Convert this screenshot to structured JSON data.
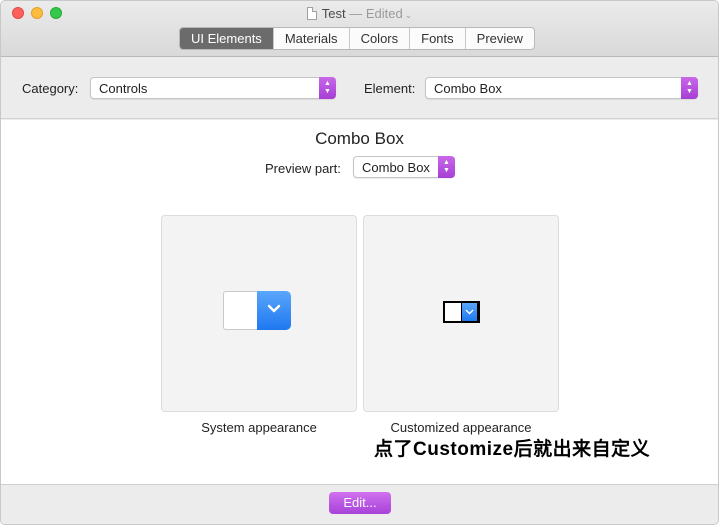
{
  "window": {
    "title": "Test",
    "edited_label": "— Edited",
    "title_chevron": "⌄"
  },
  "tabs": [
    {
      "label": "UI Elements",
      "active": true
    },
    {
      "label": "Materials",
      "active": false
    },
    {
      "label": "Colors",
      "active": false
    },
    {
      "label": "Fonts",
      "active": false
    },
    {
      "label": "Preview",
      "active": false
    }
  ],
  "category": {
    "label": "Category:",
    "value": "Controls"
  },
  "element": {
    "label": "Element:",
    "value": "Combo Box"
  },
  "main": {
    "heading": "Combo Box",
    "preview_part_label": "Preview part:",
    "preview_part_value": "Combo Box"
  },
  "panels": {
    "system_caption": "System appearance",
    "custom_caption": "Customized appearance"
  },
  "annotation": "点了Customize后就出来自定义",
  "footer": {
    "edit_label": "Edit..."
  },
  "colors": {
    "accent_purple": "#b455e0",
    "system_blue": "#2f86f6",
    "active_tab": "#6b6b6b"
  },
  "icons": {
    "popup_arrows": "up-down-chevron-icon",
    "combo_chevron": "chevron-down-icon"
  }
}
